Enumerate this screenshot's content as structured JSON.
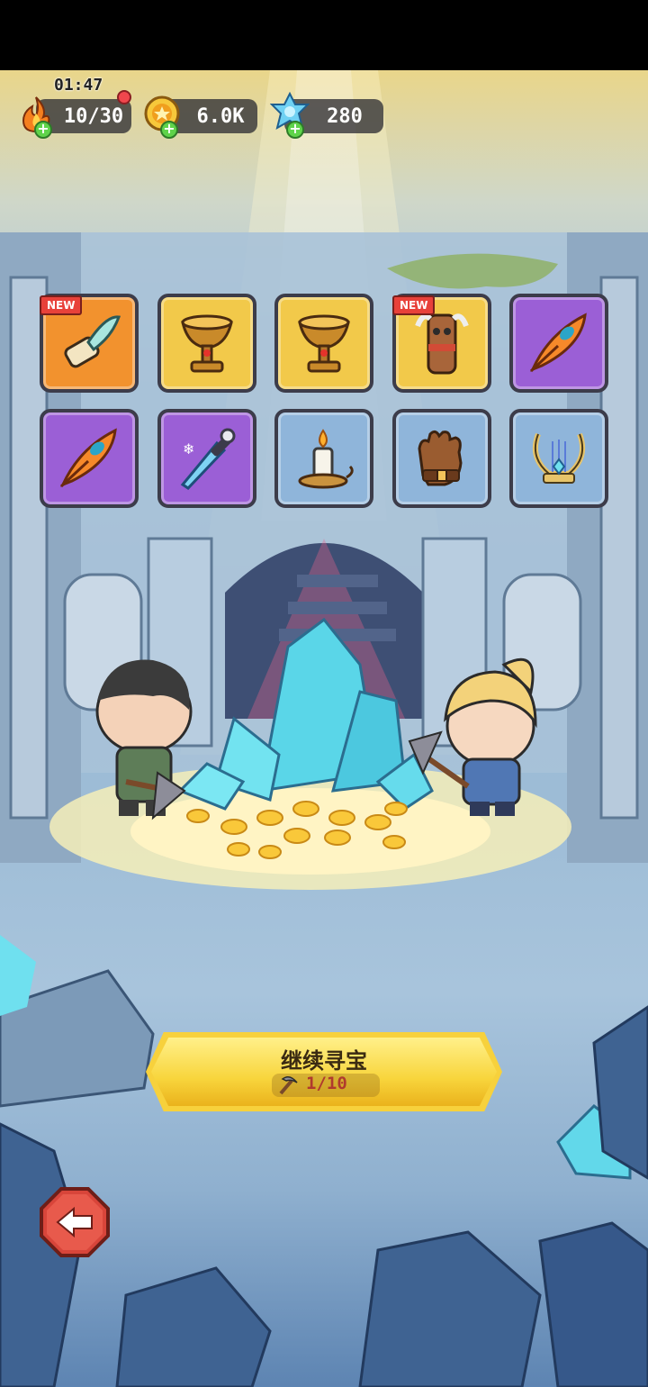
{
  "hud": {
    "timer": "01:47",
    "energy": "10/30",
    "gold": "6.0K",
    "gems": "280"
  },
  "items": [
    {
      "icon": "feather-scroll-icon",
      "rarity": "orange",
      "new": true
    },
    {
      "icon": "golden-chalice-icon",
      "rarity": "gold",
      "new": false
    },
    {
      "icon": "golden-chalice-icon",
      "rarity": "gold",
      "new": false
    },
    {
      "icon": "viking-totem-icon",
      "rarity": "gold",
      "new": true
    },
    {
      "icon": "phoenix-feather-icon",
      "rarity": "purple",
      "new": false
    },
    {
      "icon": "phoenix-feather-icon",
      "rarity": "purple",
      "new": false
    },
    {
      "icon": "frost-dagger-icon",
      "rarity": "purple",
      "new": false
    },
    {
      "icon": "candle-icon",
      "rarity": "blue",
      "new": false
    },
    {
      "icon": "leather-glove-icon",
      "rarity": "blue",
      "new": false
    },
    {
      "icon": "golden-lyre-icon",
      "rarity": "blue",
      "new": false
    }
  ],
  "new_label": "NEW",
  "continue_button": {
    "label": "继续寻宝",
    "cost": "1/10"
  },
  "colors": {
    "orange": "#f2922e",
    "gold": "#f2c94a",
    "purple": "#9b5fd6",
    "blue": "#8fb5da",
    "button": "#f7d13c"
  }
}
